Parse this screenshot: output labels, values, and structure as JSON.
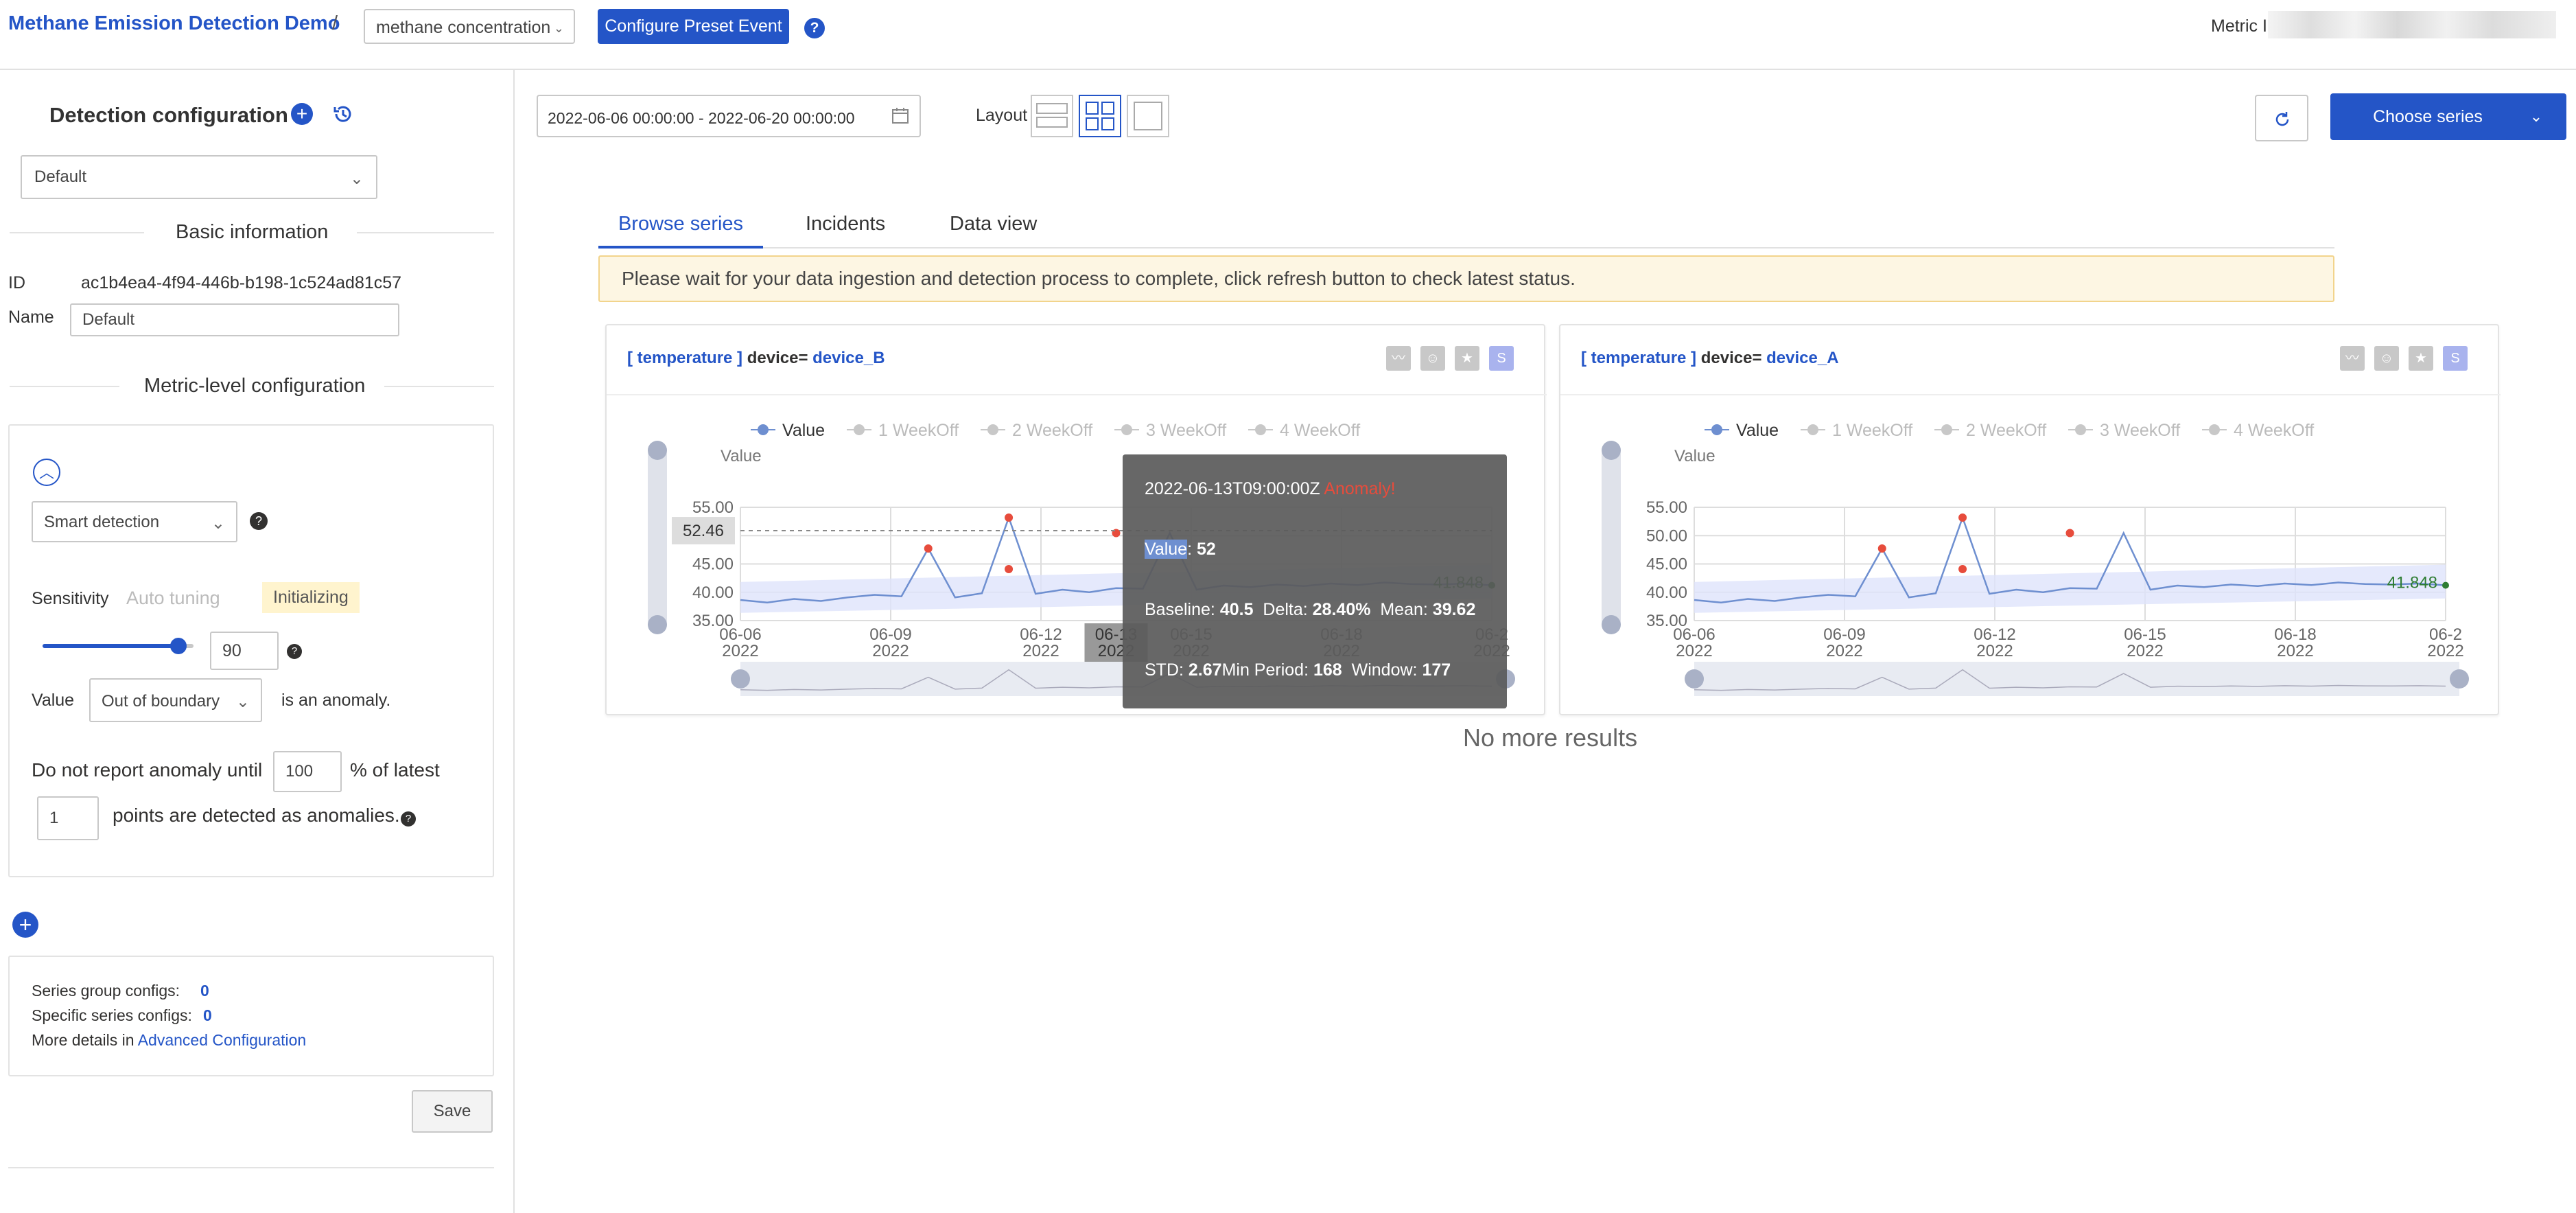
{
  "header": {
    "app_title": "Methane Emission Detection Demo",
    "separator": "/",
    "metric_selector": "methane concentration",
    "configure_preset_label": "Configure Preset Event",
    "help_icon": "?",
    "metric_id_label": "Metric ID"
  },
  "sidebar": {
    "title": "Detection configuration",
    "config_select": "Default",
    "basic_info": {
      "heading": "Basic information",
      "id_label": "ID",
      "id_value": "ac1b4ea4-4f94-446b-b198-1c524ad81c57",
      "name_label": "Name",
      "name_value": "Default"
    },
    "metric_level": {
      "heading": "Metric-level configuration",
      "detection_method": "Smart detection",
      "sensitivity_label": "Sensitivity",
      "auto_tuning_label": "Auto tuning",
      "initializing_badge": "Initializing",
      "sensitivity_value": "90",
      "sensitivity_level": 0.9,
      "value_label": "Value",
      "boundary_select": "Out of boundary",
      "is_anomaly": "is an anomaly.",
      "no_report_prefix": "Do not report anomaly until",
      "percent_value": "100",
      "percent_suffix": "% of latest",
      "points_value": "1",
      "points_suffix": "points are detected as anomalies."
    },
    "summary": {
      "series_group_label": "Series group configs:",
      "series_group_value": "0",
      "specific_series_label": "Specific series configs:",
      "specific_series_value": "0",
      "more_details_prefix": "More details in",
      "advanced_link": "Advanced Configuration"
    },
    "save_label": "Save"
  },
  "main": {
    "date_range": "2022-06-06 00:00:00 - 2022-06-20 00:00:00",
    "layout_label": "Layout",
    "choose_series_label": "Choose series",
    "tabs": [
      {
        "label": "Browse series"
      },
      {
        "label": "Incidents"
      },
      {
        "label": "Data view"
      }
    ],
    "notice": "Please wait for your data ingestion and detection process to complete, click refresh button to check latest status.",
    "no_more_results": "No more results",
    "legend": [
      "Value",
      "1 WeekOff",
      "2 WeekOff",
      "3 WeekOff",
      "4 WeekOff"
    ],
    "axis_title": "Value"
  },
  "chart_data": [
    {
      "type": "line",
      "series_title": "[ temperature ]",
      "dimension_key": "device=",
      "dimension_value": "device_B",
      "x_ticks": [
        "06-06",
        "06-09",
        "06-12",
        "06-15",
        "06-18",
        "06-2"
      ],
      "x_ticks_year": "2022",
      "y_ticks": [
        "55.00",
        "50.00",
        "45.00",
        "40.00",
        "35.00"
      ],
      "ylim": [
        35,
        57
      ],
      "x": [
        0,
        0.5,
        1,
        1.5,
        2,
        2.5,
        3,
        3.5,
        4,
        4.5,
        5,
        5.5,
        6,
        6.5,
        7,
        7.5,
        8,
        8.5,
        9,
        9.5,
        10,
        10.5,
        11,
        11.5,
        12,
        12.5,
        13,
        13.5,
        14
      ],
      "values": [
        39,
        38.5,
        39.2,
        38.8,
        39.5,
        40,
        39.7,
        49,
        39.5,
        40.3,
        55,
        40.2,
        41,
        40.5,
        41.3,
        41.2,
        52,
        41,
        41.8,
        41.5,
        42,
        41.7,
        42.2,
        41.9,
        42.4,
        42.1,
        42,
        42.2,
        41.848
      ],
      "anomalies": [
        {
          "x": 3.5,
          "y": 49
        },
        {
          "x": 5,
          "y": 55
        },
        {
          "x": 5,
          "y": 45
        },
        {
          "x": 7,
          "y": 52
        }
      ],
      "last_value_label": "41.848",
      "crosshair_value": "52.46",
      "crosshair_date_top": "06-13",
      "crosshair_date_bottom": "2022",
      "tooltip": {
        "timestamp": "2022-06-13T09:00:00Z",
        "status": "Anomaly!",
        "value_label": "Value",
        "value": "52",
        "baseline_label": "Baseline:",
        "baseline": "40.5",
        "delta_label": "Delta:",
        "delta": "28.40%",
        "mean_label": "Mean:",
        "mean": "39.62",
        "std_label": "STD:",
        "std": "2.67",
        "min_period_label": "Min Period:",
        "min_period": "168",
        "window_label": "Window:",
        "window": "177"
      }
    },
    {
      "type": "line",
      "series_title": "[ temperature ]",
      "dimension_key": "device=",
      "dimension_value": "device_A",
      "x_ticks": [
        "06-06",
        "06-09",
        "06-12",
        "06-15",
        "06-18",
        "06-2"
      ],
      "x_ticks_year": "2022",
      "y_ticks": [
        "55.00",
        "50.00",
        "45.00",
        "40.00",
        "35.00"
      ],
      "ylim": [
        35,
        57
      ],
      "x": [
        0,
        0.5,
        1,
        1.5,
        2,
        2.5,
        3,
        3.5,
        4,
        4.5,
        5,
        5.5,
        6,
        6.5,
        7,
        7.5,
        8,
        8.5,
        9,
        9.5,
        10,
        10.5,
        11,
        11.5,
        12,
        12.5,
        13,
        13.5,
        14
      ],
      "values": [
        39,
        38.5,
        39.2,
        38.8,
        39.5,
        40,
        39.7,
        49,
        39.5,
        40.3,
        55,
        40.2,
        41,
        40.5,
        41.3,
        41.2,
        52,
        41,
        41.8,
        41.5,
        42,
        41.7,
        42.2,
        41.9,
        42.4,
        42.1,
        42,
        42.2,
        41.848
      ],
      "anomalies": [
        {
          "x": 3.5,
          "y": 49
        },
        {
          "x": 5,
          "y": 55
        },
        {
          "x": 5,
          "y": 45
        },
        {
          "x": 7,
          "y": 52
        }
      ],
      "last_value_label": "41.848"
    }
  ],
  "colors": {
    "accent": "#2455c7",
    "line": "#6e8fd0",
    "band": "#dfe3fb",
    "anomaly": "#e74c3c",
    "badge_bg": "#fff4ce",
    "notice_bg": "#fdf6e3",
    "notice_border": "#f2d48c"
  }
}
